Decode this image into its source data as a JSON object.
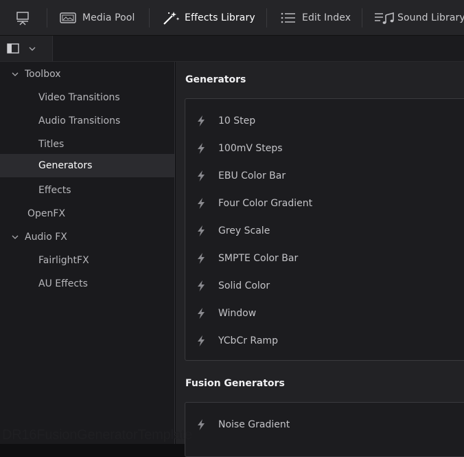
{
  "toolbar": {
    "items": [
      {
        "label": ""
      },
      {
        "label": "Media Pool"
      },
      {
        "label": "Effects Library"
      },
      {
        "label": "Edit Index"
      },
      {
        "label": "Sound Library"
      }
    ],
    "active": "Effects Library"
  },
  "sidebar": {
    "items": [
      {
        "label": "Toolbox",
        "expanded": true
      },
      {
        "label": "Video Transitions"
      },
      {
        "label": "Audio Transitions"
      },
      {
        "label": "Titles"
      },
      {
        "label": "Generators",
        "selected": true
      },
      {
        "label": "Effects"
      },
      {
        "label": "OpenFX"
      },
      {
        "label": "Audio FX",
        "expanded": true
      },
      {
        "label": "FairlightFX"
      },
      {
        "label": "AU Effects"
      }
    ]
  },
  "main": {
    "sections": [
      {
        "title": "Generators",
        "items": [
          "10 Step",
          "100mV Steps",
          "EBU Color Bar",
          "Four Color Gradient",
          "Grey Scale",
          "SMPTE Color Bar",
          "Solid Color",
          "Window",
          "YCbCr Ramp"
        ]
      },
      {
        "title": "Fusion Generators",
        "items": [
          "Noise Gradient"
        ]
      }
    ]
  },
  "caption": "DR16FusionGeneratorTemplate",
  "colors": {
    "background": "#222225",
    "sidebar": "#1a1a1d",
    "selected": "#2b2b2f",
    "topbar": "#252528"
  },
  "icons": [
    "layout-icon",
    "media-pool-icon",
    "effects-wand-icon",
    "edit-index-icon",
    "sound-library-icon",
    "panel-toggle-icon",
    "chevron-down-icon",
    "bolt-icon"
  ]
}
